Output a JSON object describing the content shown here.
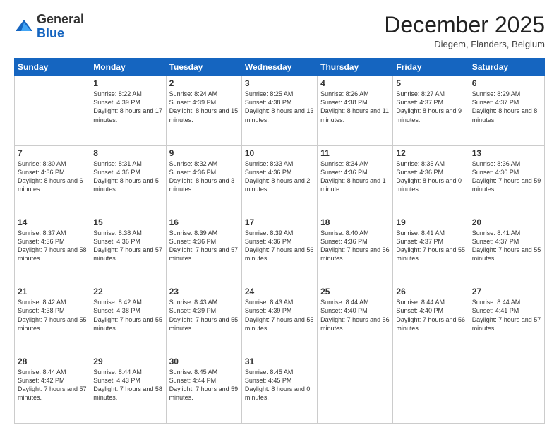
{
  "header": {
    "logo": {
      "general": "General",
      "blue": "Blue"
    },
    "title": "December 2025",
    "location": "Diegem, Flanders, Belgium"
  },
  "days_of_week": [
    "Sunday",
    "Monday",
    "Tuesday",
    "Wednesday",
    "Thursday",
    "Friday",
    "Saturday"
  ],
  "weeks": [
    [
      {
        "day": "",
        "info": ""
      },
      {
        "day": "1",
        "info": "Sunrise: 8:22 AM\nSunset: 4:39 PM\nDaylight: 8 hours\nand 17 minutes."
      },
      {
        "day": "2",
        "info": "Sunrise: 8:24 AM\nSunset: 4:39 PM\nDaylight: 8 hours\nand 15 minutes."
      },
      {
        "day": "3",
        "info": "Sunrise: 8:25 AM\nSunset: 4:38 PM\nDaylight: 8 hours\nand 13 minutes."
      },
      {
        "day": "4",
        "info": "Sunrise: 8:26 AM\nSunset: 4:38 PM\nDaylight: 8 hours\nand 11 minutes."
      },
      {
        "day": "5",
        "info": "Sunrise: 8:27 AM\nSunset: 4:37 PM\nDaylight: 8 hours\nand 9 minutes."
      },
      {
        "day": "6",
        "info": "Sunrise: 8:29 AM\nSunset: 4:37 PM\nDaylight: 8 hours\nand 8 minutes."
      }
    ],
    [
      {
        "day": "7",
        "info": "Sunrise: 8:30 AM\nSunset: 4:36 PM\nDaylight: 8 hours\nand 6 minutes."
      },
      {
        "day": "8",
        "info": "Sunrise: 8:31 AM\nSunset: 4:36 PM\nDaylight: 8 hours\nand 5 minutes."
      },
      {
        "day": "9",
        "info": "Sunrise: 8:32 AM\nSunset: 4:36 PM\nDaylight: 8 hours\nand 3 minutes."
      },
      {
        "day": "10",
        "info": "Sunrise: 8:33 AM\nSunset: 4:36 PM\nDaylight: 8 hours\nand 2 minutes."
      },
      {
        "day": "11",
        "info": "Sunrise: 8:34 AM\nSunset: 4:36 PM\nDaylight: 8 hours\nand 1 minute."
      },
      {
        "day": "12",
        "info": "Sunrise: 8:35 AM\nSunset: 4:36 PM\nDaylight: 8 hours\nand 0 minutes."
      },
      {
        "day": "13",
        "info": "Sunrise: 8:36 AM\nSunset: 4:36 PM\nDaylight: 7 hours\nand 59 minutes."
      }
    ],
    [
      {
        "day": "14",
        "info": "Sunrise: 8:37 AM\nSunset: 4:36 PM\nDaylight: 7 hours\nand 58 minutes."
      },
      {
        "day": "15",
        "info": "Sunrise: 8:38 AM\nSunset: 4:36 PM\nDaylight: 7 hours\nand 57 minutes."
      },
      {
        "day": "16",
        "info": "Sunrise: 8:39 AM\nSunset: 4:36 PM\nDaylight: 7 hours\nand 57 minutes."
      },
      {
        "day": "17",
        "info": "Sunrise: 8:39 AM\nSunset: 4:36 PM\nDaylight: 7 hours\nand 56 minutes."
      },
      {
        "day": "18",
        "info": "Sunrise: 8:40 AM\nSunset: 4:36 PM\nDaylight: 7 hours\nand 56 minutes."
      },
      {
        "day": "19",
        "info": "Sunrise: 8:41 AM\nSunset: 4:37 PM\nDaylight: 7 hours\nand 55 minutes."
      },
      {
        "day": "20",
        "info": "Sunrise: 8:41 AM\nSunset: 4:37 PM\nDaylight: 7 hours\nand 55 minutes."
      }
    ],
    [
      {
        "day": "21",
        "info": "Sunrise: 8:42 AM\nSunset: 4:38 PM\nDaylight: 7 hours\nand 55 minutes."
      },
      {
        "day": "22",
        "info": "Sunrise: 8:42 AM\nSunset: 4:38 PM\nDaylight: 7 hours\nand 55 minutes."
      },
      {
        "day": "23",
        "info": "Sunrise: 8:43 AM\nSunset: 4:39 PM\nDaylight: 7 hours\nand 55 minutes."
      },
      {
        "day": "24",
        "info": "Sunrise: 8:43 AM\nSunset: 4:39 PM\nDaylight: 7 hours\nand 55 minutes."
      },
      {
        "day": "25",
        "info": "Sunrise: 8:44 AM\nSunset: 4:40 PM\nDaylight: 7 hours\nand 56 minutes."
      },
      {
        "day": "26",
        "info": "Sunrise: 8:44 AM\nSunset: 4:40 PM\nDaylight: 7 hours\nand 56 minutes."
      },
      {
        "day": "27",
        "info": "Sunrise: 8:44 AM\nSunset: 4:41 PM\nDaylight: 7 hours\nand 57 minutes."
      }
    ],
    [
      {
        "day": "28",
        "info": "Sunrise: 8:44 AM\nSunset: 4:42 PM\nDaylight: 7 hours\nand 57 minutes."
      },
      {
        "day": "29",
        "info": "Sunrise: 8:44 AM\nSunset: 4:43 PM\nDaylight: 7 hours\nand 58 minutes."
      },
      {
        "day": "30",
        "info": "Sunrise: 8:45 AM\nSunset: 4:44 PM\nDaylight: 7 hours\nand 59 minutes."
      },
      {
        "day": "31",
        "info": "Sunrise: 8:45 AM\nSunset: 4:45 PM\nDaylight: 8 hours\nand 0 minutes."
      },
      {
        "day": "",
        "info": ""
      },
      {
        "day": "",
        "info": ""
      },
      {
        "day": "",
        "info": ""
      }
    ]
  ]
}
